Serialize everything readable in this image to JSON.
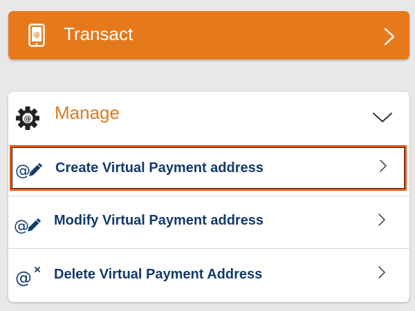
{
  "transact": {
    "label": "Transact",
    "icon": "mobile-at-icon",
    "color": "#e5791c"
  },
  "manage": {
    "title": "Manage",
    "icon": "gear-at-icon",
    "title_color": "#e07b1f",
    "expanded": true,
    "items": [
      {
        "label": "Create Virtual Payment address",
        "icon": "at-pencil-icon",
        "selected": true
      },
      {
        "label": "Modify Virtual Payment address",
        "icon": "at-pencil-icon",
        "selected": false
      },
      {
        "label": "Delete Virtual Payment Address",
        "icon": "at-cross-icon",
        "selected": false
      }
    ]
  },
  "colors": {
    "background": "#e8e8e8",
    "item_text": "#123a6b",
    "selection_border": "#e05a1c"
  }
}
